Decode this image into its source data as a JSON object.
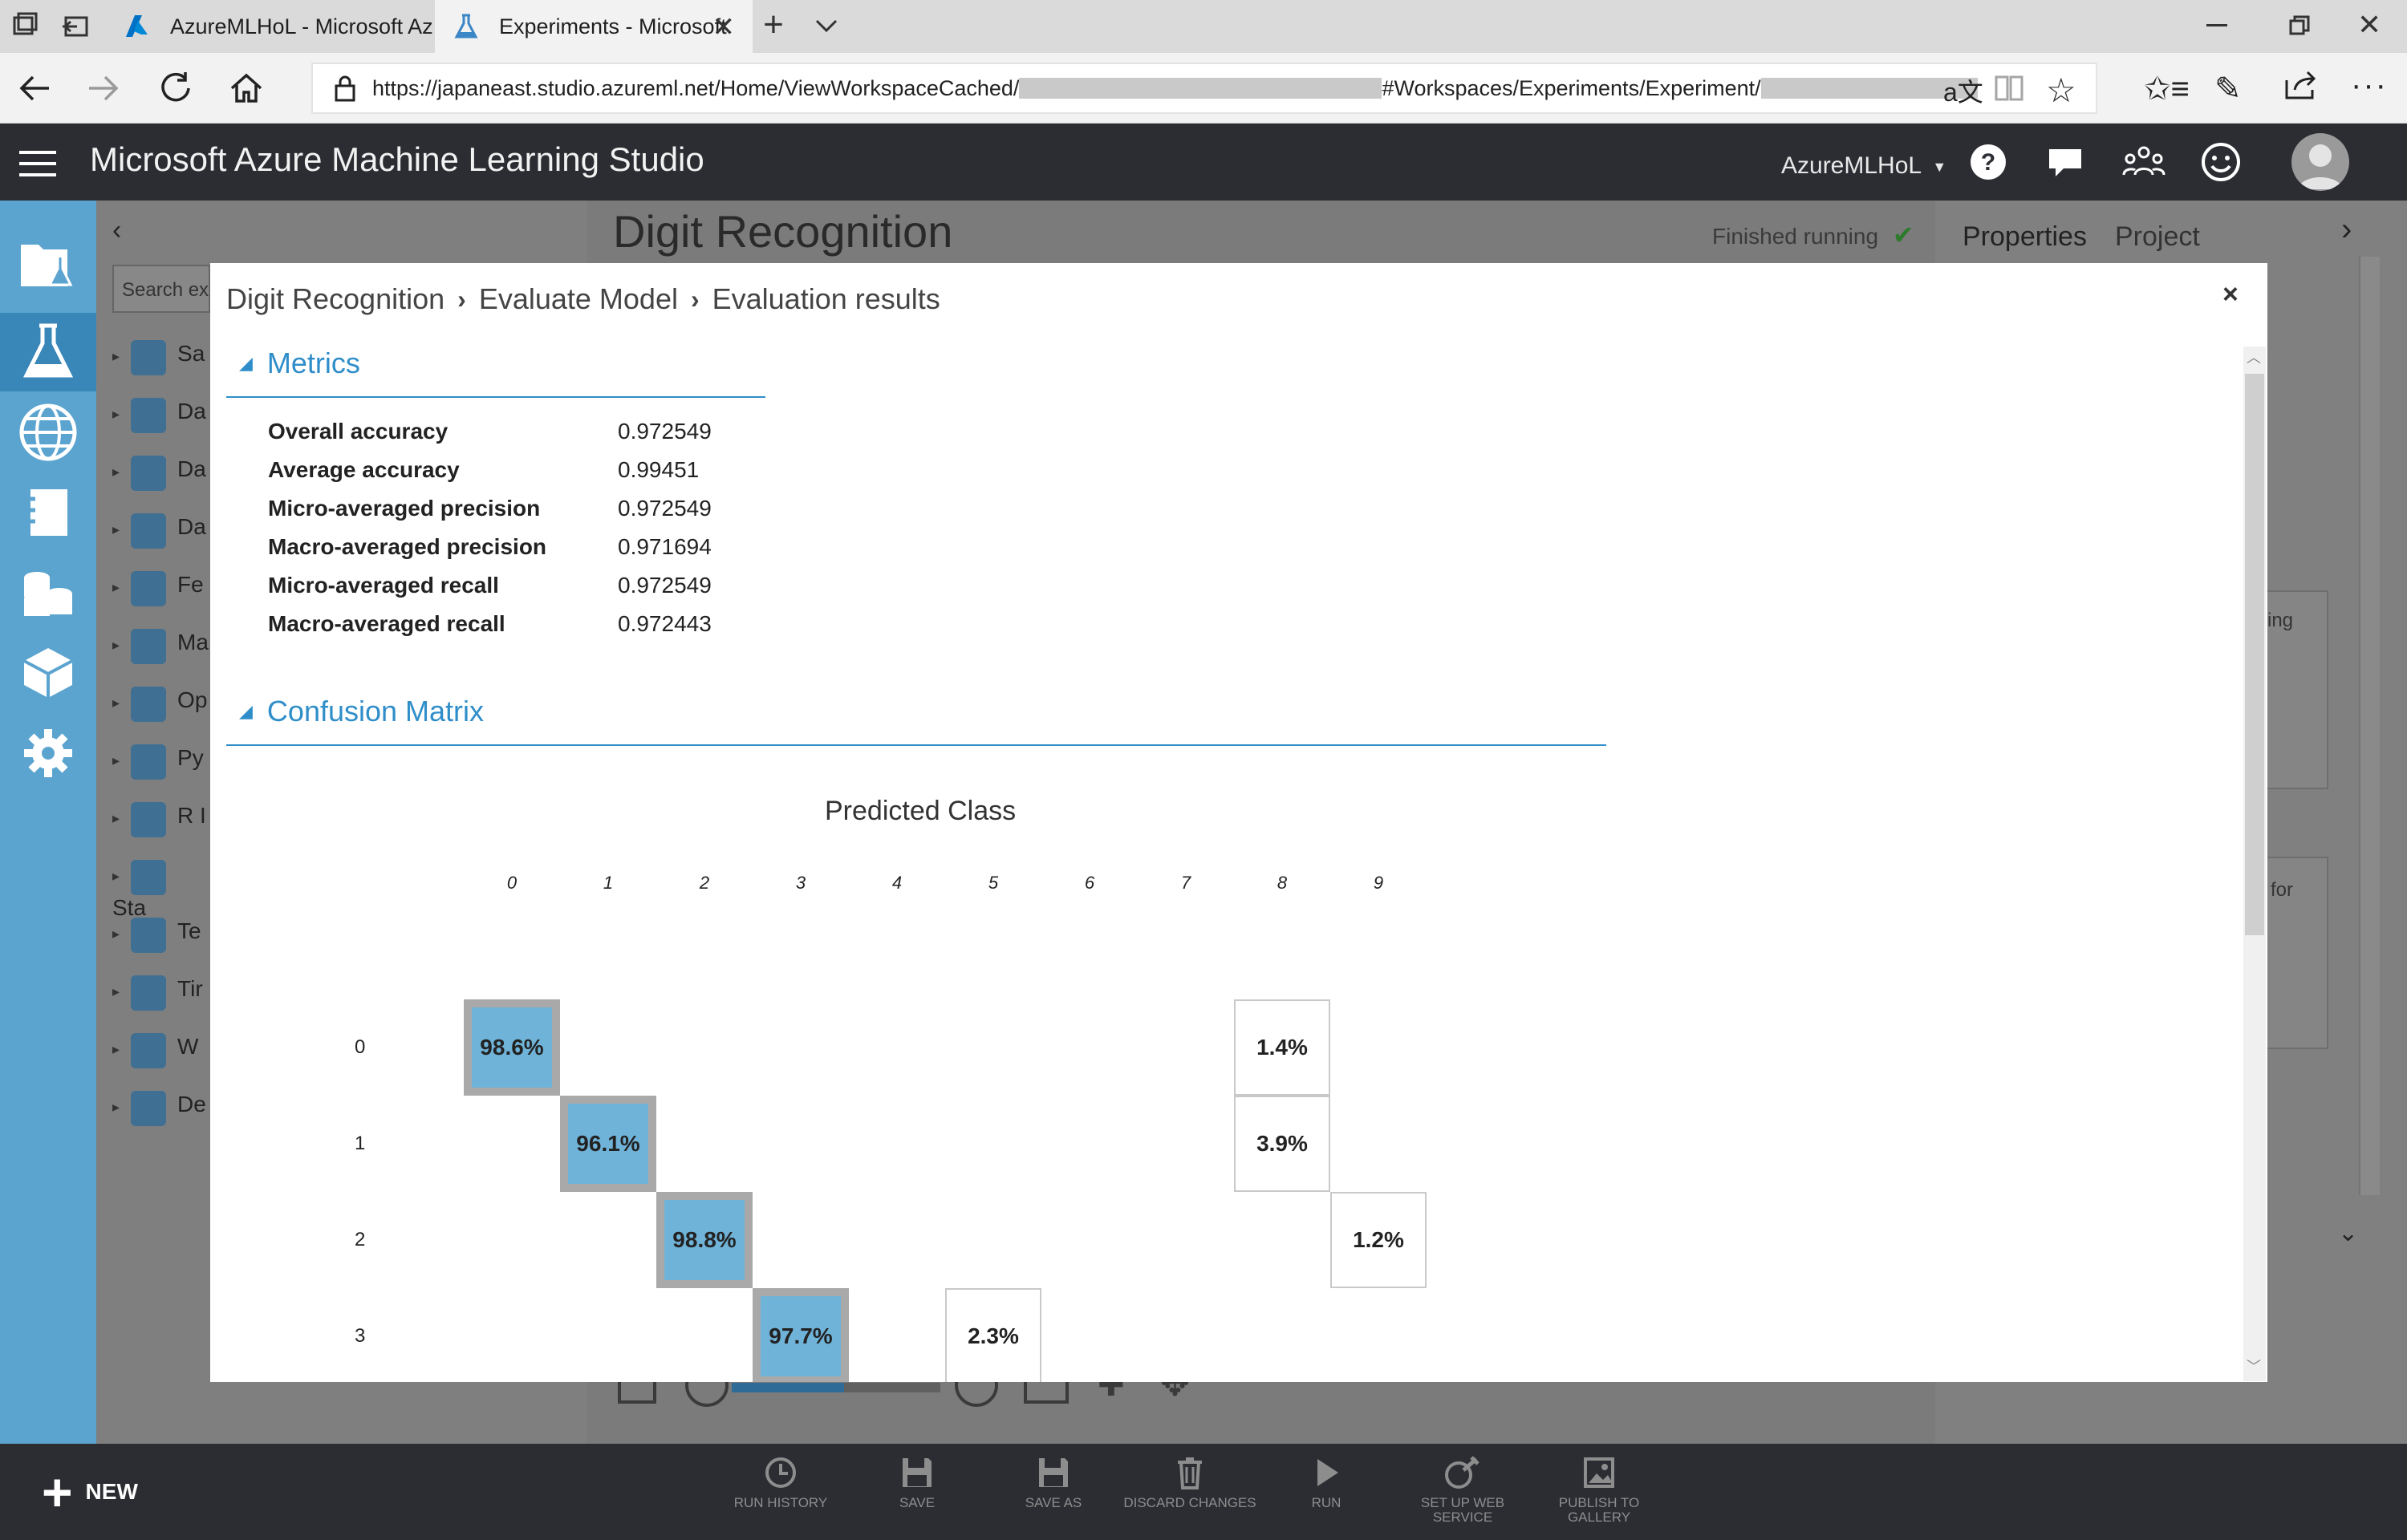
{
  "browser": {
    "tabs": [
      {
        "label": "AzureMLHoL - Microsoft Az"
      },
      {
        "label": "Experiments - Microsoft"
      }
    ],
    "url_prefix": "https://japaneast.studio.azureml.net/Home/ViewWorkspaceCached/",
    "url_middle": "#Workspaces/Experiments/Experiment/"
  },
  "header": {
    "title": "Microsoft Azure Machine Learning Studio",
    "workspace": "AzureMLHoL"
  },
  "palette": {
    "search_placeholder": "Search ex",
    "items": [
      "Sa",
      "Da",
      "Da",
      "Da",
      "Fe",
      "Ma",
      "Op",
      "Py",
      "R I",
      "Sta",
      "Te",
      "Tir",
      "W",
      "De"
    ]
  },
  "canvas": {
    "experiment_title": "Digit Recognition",
    "status": "Finished running"
  },
  "properties": {
    "tab_properties": "Properties",
    "tab_project": "Project",
    "snippet1": "ing",
    "snippet2": "for"
  },
  "modal": {
    "breadcrumb": [
      "Digit Recognition",
      "Evaluate Model",
      "Evaluation results"
    ],
    "close": "×",
    "metrics_title": "Metrics",
    "metrics": [
      {
        "label": "Overall accuracy",
        "value": "0.972549"
      },
      {
        "label": "Average accuracy",
        "value": "0.99451"
      },
      {
        "label": "Micro-averaged precision",
        "value": "0.972549"
      },
      {
        "label": "Macro-averaged precision",
        "value": "0.971694"
      },
      {
        "label": "Micro-averaged recall",
        "value": "0.972549"
      },
      {
        "label": "Macro-averaged recall",
        "value": "0.972443"
      }
    ],
    "confusion_title": "Confusion Matrix"
  },
  "chart_data": {
    "type": "heatmap",
    "title": "Predicted Class",
    "x_labels": [
      "0",
      "1",
      "2",
      "3",
      "4",
      "5",
      "6",
      "7",
      "8",
      "9"
    ],
    "y_labels": [
      "0",
      "1",
      "2",
      "3"
    ],
    "cells": [
      {
        "row": 0,
        "col": 0,
        "label": "98.6%",
        "value": 98.6,
        "diagonal": true
      },
      {
        "row": 0,
        "col": 8,
        "label": "1.4%",
        "value": 1.4,
        "diagonal": false
      },
      {
        "row": 1,
        "col": 1,
        "label": "96.1%",
        "value": 96.1,
        "diagonal": true
      },
      {
        "row": 1,
        "col": 8,
        "label": "3.9%",
        "value": 3.9,
        "diagonal": false
      },
      {
        "row": 2,
        "col": 2,
        "label": "98.8%",
        "value": 98.8,
        "diagonal": true
      },
      {
        "row": 2,
        "col": 9,
        "label": "1.2%",
        "value": 1.2,
        "diagonal": false
      },
      {
        "row": 3,
        "col": 3,
        "label": "97.7%",
        "value": 97.7,
        "diagonal": true
      },
      {
        "row": 3,
        "col": 5,
        "label": "2.3%",
        "value": 2.3,
        "diagonal": false
      }
    ]
  },
  "bottombar": {
    "new_label": "NEW",
    "buttons": [
      {
        "label": "RUN HISTORY"
      },
      {
        "label": "SAVE"
      },
      {
        "label": "SAVE AS"
      },
      {
        "label": "DISCARD CHANGES"
      },
      {
        "label": "RUN"
      },
      {
        "label": "SET UP WEB SERVICE"
      },
      {
        "label": "PUBLISH TO GALLERY"
      }
    ]
  }
}
